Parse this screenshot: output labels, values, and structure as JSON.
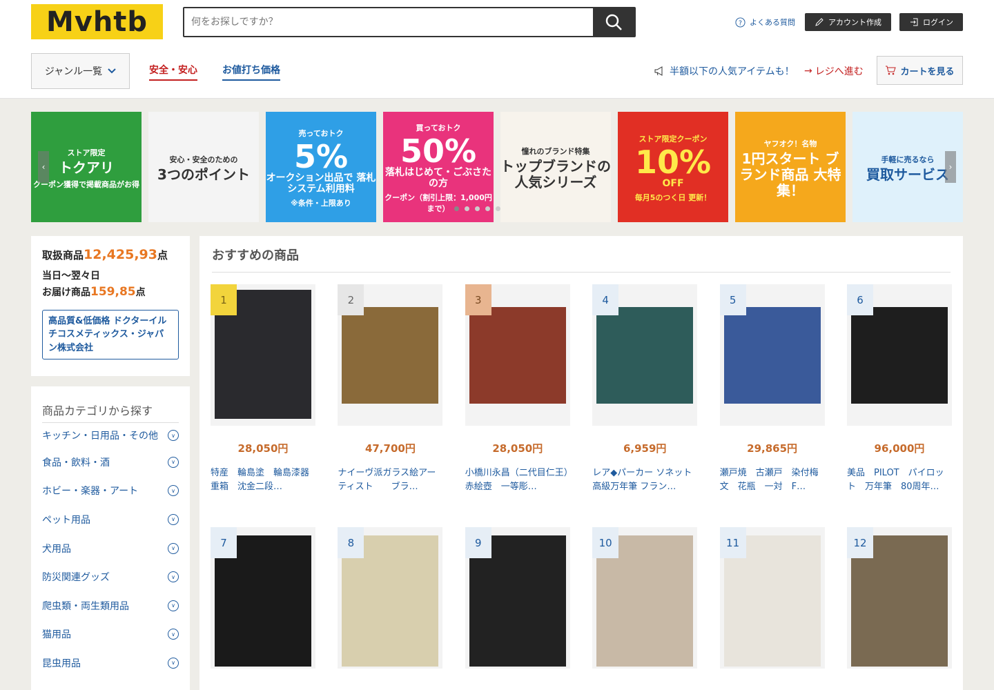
{
  "header": {
    "logo": "Mvhtb",
    "search_placeholder": "何をお探しですか？",
    "faq": "よくある質問",
    "signup": "アカウント作成",
    "login": "ログイン"
  },
  "subnav": {
    "genre": "ジャンル一覧",
    "safe": "安全・安心",
    "bargain": "お値打ち価格",
    "promo": "半額以下の人気アイテムも！",
    "register": "レジへ進む",
    "cart": "カートを見る"
  },
  "banners": [
    {
      "top": "ストア限定",
      "main": "トクアリ",
      "sub": "クーポン獲得で掲載商品がお得",
      "bg": "#2f9e3e",
      "fg": "#ffffff"
    },
    {
      "top": "安心・安全のための",
      "main": "3つのポイント",
      "sub": "",
      "bg": "#f4f4f4",
      "fg": "#333333"
    },
    {
      "top": "売っておトク",
      "main": "オークション出品で 落札システム利用料",
      "big": "5%",
      "sub": "※条件・上限あり",
      "bg": "#2f9fe6",
      "fg": "#ffffff"
    },
    {
      "top": "買っておトク",
      "main": "落札はじめて・ごぶさたの方",
      "big": "50%",
      "sub": "クーポン（割引上限：1,000円まで）",
      "bg": "#e9337c",
      "fg": "#ffffff"
    },
    {
      "top": "憧れのブランド特集",
      "main": "トップブランドの 人気シリーズ",
      "sub": "",
      "bg": "#f7f3ec",
      "fg": "#333333"
    },
    {
      "top": "ストア限定クーポン",
      "big": "10%",
      "main": "OFF",
      "sub": "毎月5のつく日 更新！",
      "bg": "#e12f24",
      "fg": "#ffe94a"
    },
    {
      "top": "ヤフオク！名物",
      "main": "1円スタート ブランド商品 大特集！",
      "sub": "",
      "bg": "#f5a81c",
      "fg": "#ffffff"
    },
    {
      "top": "手軽に売るなら",
      "main": "買取サービス",
      "sub": "",
      "bg": "#dff1fb",
      "fg": "#1e5a9e"
    }
  ],
  "stats": {
    "label1": "取扱商品",
    "count1": "12,425,93",
    "unit1": "点",
    "label2a": "当日〜翌々日",
    "label2b": "お届け商品",
    "count2": "159,85",
    "unit2": "点",
    "seller": "高品質&低価格 ドクターイルチコスメティックス・ジャパン株式会社"
  },
  "categories": {
    "title": "商品カテゴリから探す",
    "items": [
      "キッチン・日用品・その他",
      "食品・飲料・酒",
      "ホビー・楽器・アート",
      "ペット用品",
      "犬用品",
      "防災関連グッズ",
      "爬虫類・両生類用品",
      "猫用品",
      "昆虫用品"
    ]
  },
  "recommend": {
    "title": "おすすめの商品",
    "products": [
      {
        "rank": "1",
        "price": "28,050円",
        "name": "特産　輪島塗　輪島漆器　重箱　沈金二段…",
        "color": "#2a2a2e"
      },
      {
        "rank": "2",
        "price": "47,700円",
        "name": "ナイーヴ派ガラス絵アーティスト　　ブラ…",
        "color": "#8a6a3a"
      },
      {
        "rank": "3",
        "price": "28,050円",
        "name": "小橋川永昌（二代目仁王）赤絵壺　一等彫…",
        "color": "#8c3a2a"
      },
      {
        "rank": "4",
        "price": "6,959円",
        "name": "レア◆パーカー ソネット高級万年筆 フラン…",
        "color": "#2e5c5a"
      },
      {
        "rank": "5",
        "price": "29,865円",
        "name": "瀬戸焼　古瀬戸　染付梅文　花瓶　一対　F…",
        "color": "#3a5a9a"
      },
      {
        "rank": "6",
        "price": "96,000円",
        "name": "美品　PILOT　パイロット　万年筆　80周年…",
        "color": "#1e1e1e"
      },
      {
        "rank": "7",
        "price": "",
        "name": "",
        "color": "#1a1a1a"
      },
      {
        "rank": "8",
        "price": "",
        "name": "",
        "color": "#d8cfae"
      },
      {
        "rank": "9",
        "price": "",
        "name": "",
        "color": "#222222"
      },
      {
        "rank": "10",
        "price": "",
        "name": "",
        "color": "#c8b9a6"
      },
      {
        "rank": "11",
        "price": "",
        "name": "",
        "color": "#e8e4dc"
      },
      {
        "rank": "12",
        "price": "",
        "name": "",
        "color": "#7a6a52"
      }
    ]
  }
}
